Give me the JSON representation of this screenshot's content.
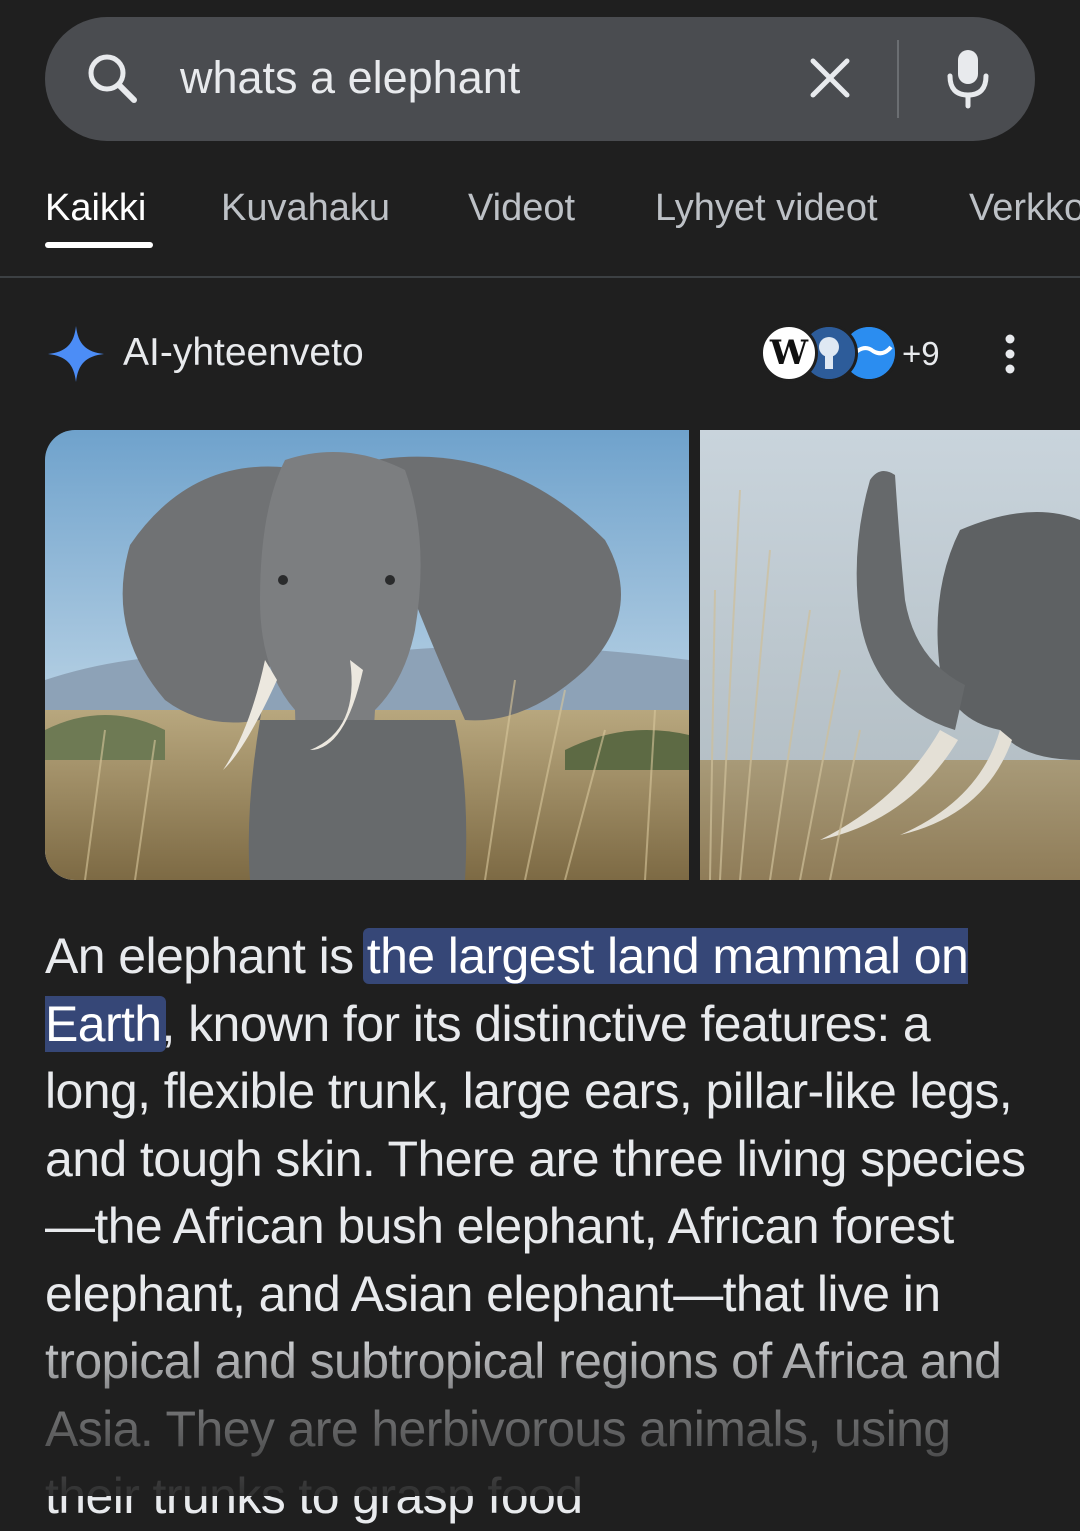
{
  "search": {
    "query": "whats a elephant"
  },
  "tabs": [
    {
      "label": "Kaikki"
    },
    {
      "label": "Kuvahaku"
    },
    {
      "label": "Videot"
    },
    {
      "label": "Lyhyet videot"
    },
    {
      "label": "Verkko"
    }
  ],
  "ai_overview": {
    "title": "AI-yhteenveto",
    "sources_count": "+9",
    "source_badge_w": "W",
    "summary": {
      "before": "An elephant is ",
      "highlight": "the largest land mammal on Earth",
      "after": ", known for its distinctive features: a long, flexible trunk, large ears, pillar-like legs, and tough skin. There are three living species—the African bush elephant, African forest elephant, and Asian elephant—that live in tropical and subtropical regions of Africa and Asia. They are herbivorous animals, using their trunks to grasp food"
    }
  },
  "colors": {
    "background": "#1f1f1f",
    "searchbar": "#4a4c50",
    "highlight": "#364777",
    "ai_star": "#4c8df6"
  }
}
